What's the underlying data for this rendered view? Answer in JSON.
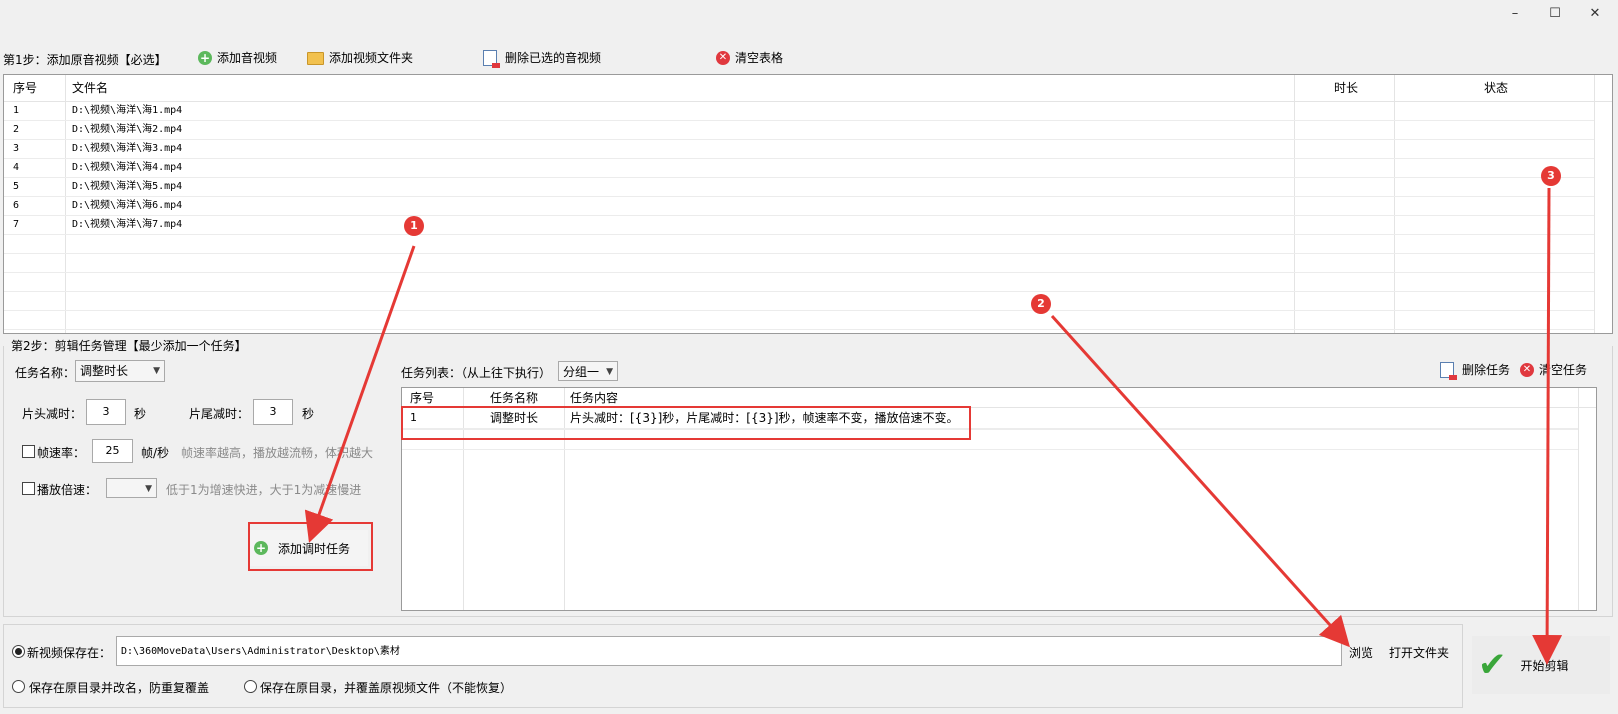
{
  "window": {
    "minimize": "–",
    "maximize": "☐",
    "close": "✕"
  },
  "step1": {
    "title": "第1步：添加原音视频【必选】",
    "add_av": "添加音视频",
    "add_folder": "添加视频文件夹",
    "delete_selected": "删除已选的音视频",
    "clear_table": "清空表格"
  },
  "file_table": {
    "headers": {
      "index": "序号",
      "filename": "文件名",
      "duration": "时长",
      "status": "状态"
    },
    "rows": [
      {
        "index": "1",
        "filename": "D:\\视频\\海洋\\海1.mp4"
      },
      {
        "index": "2",
        "filename": "D:\\视频\\海洋\\海2.mp4"
      },
      {
        "index": "3",
        "filename": "D:\\视频\\海洋\\海3.mp4"
      },
      {
        "index": "4",
        "filename": "D:\\视频\\海洋\\海4.mp4"
      },
      {
        "index": "5",
        "filename": "D:\\视频\\海洋\\海5.mp4"
      },
      {
        "index": "6",
        "filename": "D:\\视频\\海洋\\海6.mp4"
      },
      {
        "index": "7",
        "filename": "D:\\视频\\海洋\\海7.mp4"
      }
    ]
  },
  "step2": {
    "title": "第2步：剪辑任务管理【最少添加一个任务】",
    "task_name_label": "任务名称：",
    "task_name_value": "调整时长",
    "head_cut_label": "片头减时：",
    "head_cut_value": "3",
    "head_cut_unit": "秒",
    "tail_cut_label": "片尾减时：",
    "tail_cut_value": "3",
    "tail_cut_unit": "秒",
    "fps_label": "帧速率：",
    "fps_value": "25",
    "fps_unit": "帧/秒",
    "fps_hint": "帧速率越高，播放越流畅，体积越大",
    "speed_label": "播放倍速：",
    "speed_value": "",
    "speed_hint": "低于1为增速快进，大于1为减速慢进",
    "add_task_button": "添加调时任务",
    "task_list_label": "任务列表：（从上往下执行）",
    "group_value": "分组一",
    "delete_task": "删除任务",
    "clear_tasks": "清空任务",
    "task_headers": {
      "index": "序号",
      "name": "任务名称",
      "content": "任务内容"
    },
    "tasks": [
      {
        "index": "1",
        "name": "调整时长",
        "content": "片头减时：[{3}]秒，片尾减时：[{3}]秒，帧速率不变，播放倍速不变。"
      }
    ]
  },
  "output": {
    "save_to_label": "新视频保存在：",
    "save_path": "D:\\360MoveData\\Users\\Administrator\\Desktop\\素材",
    "browse": "浏览",
    "open_folder": "打开文件夹",
    "option_rename": "保存在原目录并改名，防重复覆盖",
    "option_overwrite": "保存在原目录，并覆盖原视频文件（不能恢复）",
    "start_button": "开始剪辑"
  },
  "annotations": [
    "1",
    "2",
    "3"
  ],
  "colors": {
    "annotation_red": "#e53935",
    "start_check_green": "#3aa63a"
  }
}
